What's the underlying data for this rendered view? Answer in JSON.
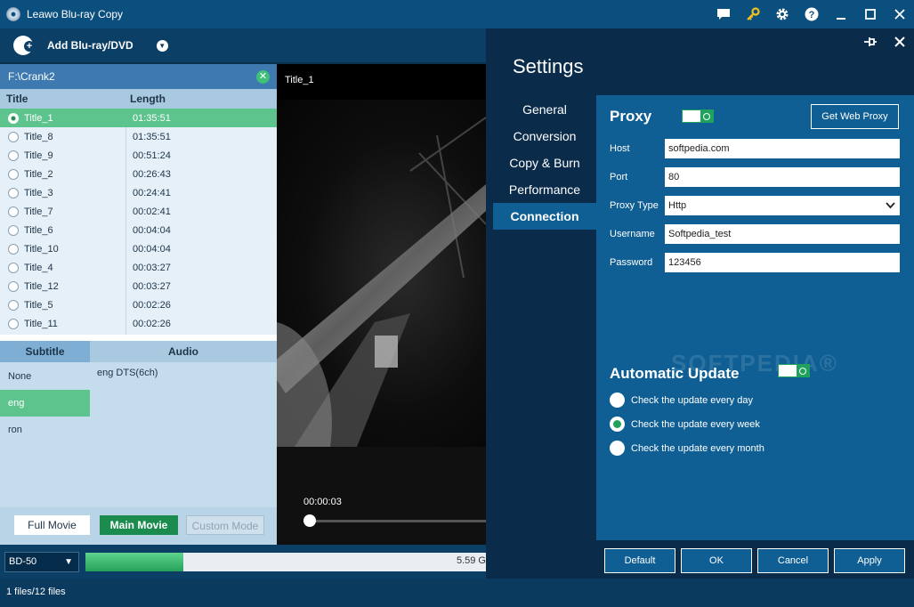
{
  "window": {
    "title": "Leawo Blu-ray Copy"
  },
  "toolbar": {
    "add_label": "Add Blu-ray/DVD"
  },
  "source": {
    "path": "F:\\Crank2"
  },
  "title_list": {
    "col_title": "Title",
    "col_length": "Length",
    "rows": [
      {
        "name": "Title_1",
        "length": "01:35:51"
      },
      {
        "name": "Title_8",
        "length": "01:35:51"
      },
      {
        "name": "Title_9",
        "length": "00:51:24"
      },
      {
        "name": "Title_2",
        "length": "00:26:43"
      },
      {
        "name": "Title_3",
        "length": "00:24:41"
      },
      {
        "name": "Title_7",
        "length": "00:02:41"
      },
      {
        "name": "Title_6",
        "length": "00:04:04"
      },
      {
        "name": "Title_10",
        "length": "00:04:04"
      },
      {
        "name": "Title_4",
        "length": "00:03:27"
      },
      {
        "name": "Title_12",
        "length": "00:03:27"
      },
      {
        "name": "Title_5",
        "length": "00:02:26"
      },
      {
        "name": "Title_11",
        "length": "00:02:26"
      }
    ]
  },
  "tracks": {
    "subtitle_header": "Subtitle",
    "audio_header": "Audio",
    "subtitles": [
      "None",
      "eng",
      "ron"
    ],
    "audio": [
      "eng DTS(6ch)"
    ]
  },
  "modes": {
    "full": "Full Movie",
    "main": "Main Movie",
    "custom": "Custom Mode"
  },
  "preview": {
    "title": "Title_1",
    "time": "00:00:03"
  },
  "disc": {
    "type": "BD-50",
    "size": "5.59 G",
    "fill_fraction": 0.245
  },
  "status": {
    "text": "1 files/12 files"
  },
  "settings": {
    "title": "Settings",
    "nav": [
      "General",
      "Conversion",
      "Copy & Burn",
      "Performance",
      "Connection"
    ],
    "proxy": {
      "title": "Proxy",
      "web_proxy_button": "Get Web Proxy",
      "host_label": "Host",
      "host_value": "softpedia.com",
      "port_label": "Port",
      "port_value": "80",
      "type_label": "Proxy Type",
      "type_value": "Http",
      "user_label": "Username",
      "user_value": "Softpedia_test",
      "pass_label": "Password",
      "pass_value": "123456"
    },
    "update": {
      "title": "Automatic Update",
      "options": [
        "Check the update every day",
        "Check the update every week",
        "Check the update every month"
      ]
    },
    "watermark": "SOFTPEDIA®",
    "buttons": {
      "default": "Default",
      "ok": "OK",
      "cancel": "Cancel",
      "apply": "Apply"
    }
  }
}
